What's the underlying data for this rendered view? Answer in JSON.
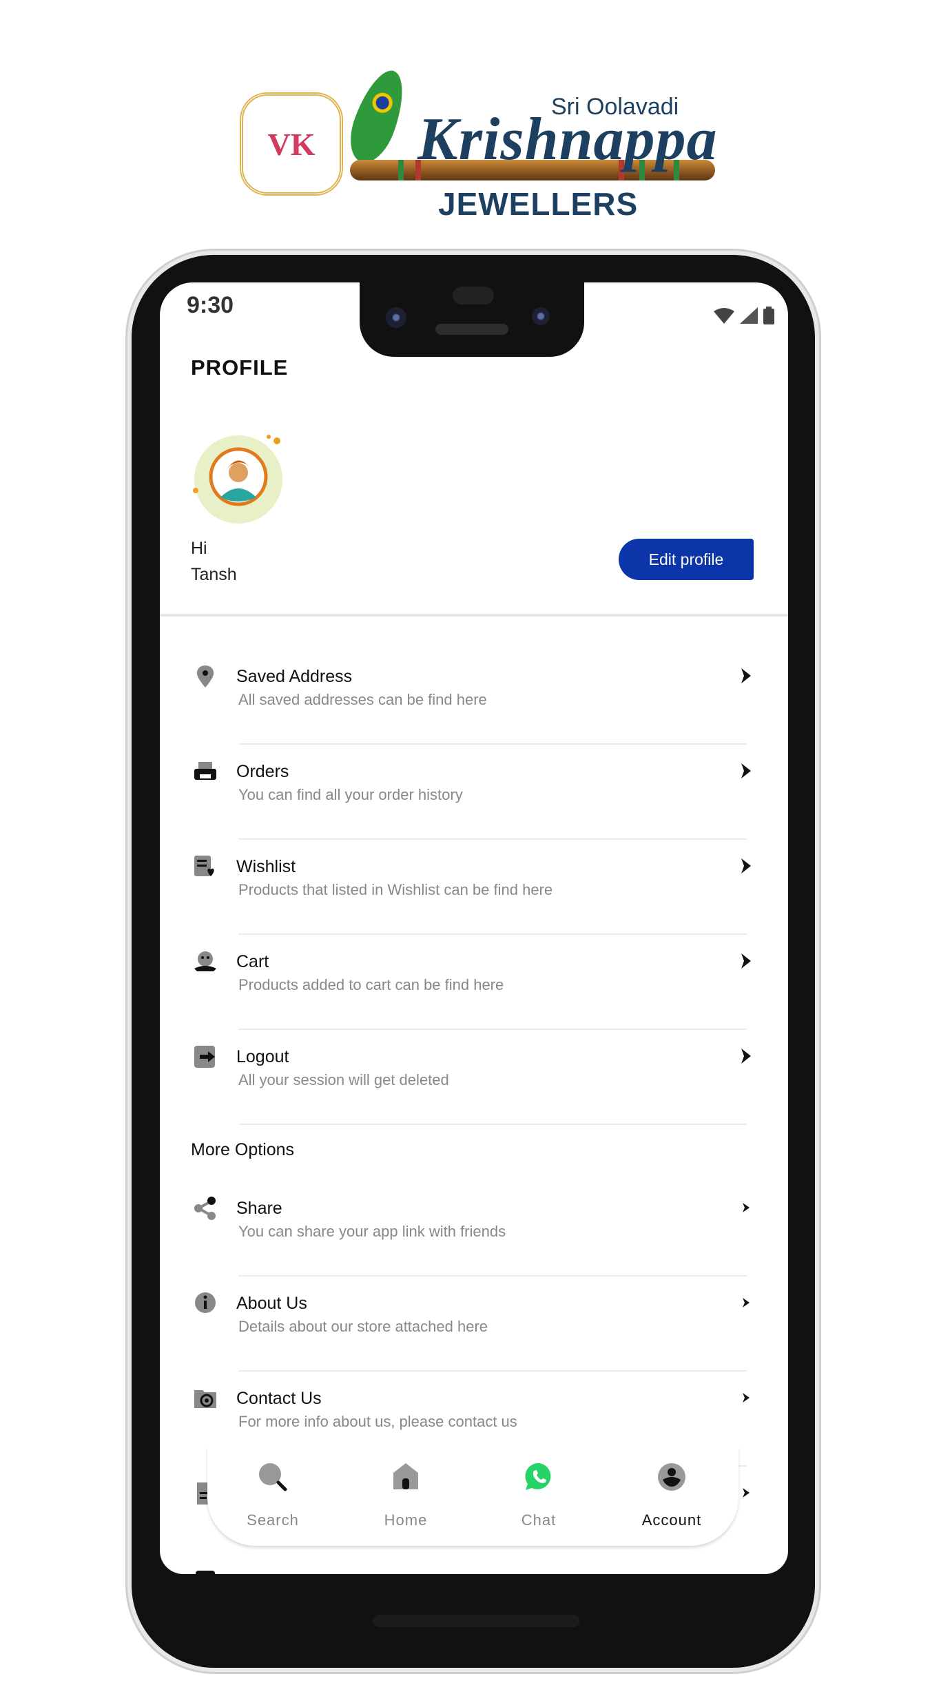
{
  "logo": {
    "monogram": "VK",
    "line1": "Sri Oolavadi",
    "line2": "Krishnappa",
    "line3": "JEWELLERS"
  },
  "status_bar": {
    "time": "9:30",
    "icons": [
      "wifi-icon",
      "signal-icon",
      "battery-icon"
    ]
  },
  "header": {
    "title": "PROFILE"
  },
  "profile": {
    "greeting": "Hi",
    "name": "Tansh",
    "edit_label": "Edit profile"
  },
  "colors": {
    "accent": "#0b35a8",
    "chat": "#25d366"
  },
  "menu": [
    {
      "icon": "location-pin-icon",
      "title": "Saved Address",
      "subtitle": "All saved addresses can be find here"
    },
    {
      "icon": "orders-icon",
      "title": "Orders",
      "subtitle": "You can find all your order history"
    },
    {
      "icon": "wishlist-icon",
      "title": "Wishlist",
      "subtitle": "Products that listed in Wishlist can be find here"
    },
    {
      "icon": "cart-icon",
      "title": "Cart",
      "subtitle": "Products added to cart can be find here"
    },
    {
      "icon": "logout-icon",
      "title": "Logout",
      "subtitle": "All your session will get deleted"
    }
  ],
  "more_options": {
    "label": "More Options",
    "items": [
      {
        "icon": "share-icon",
        "title": "Share",
        "subtitle": "You can share your app link with friends"
      },
      {
        "icon": "info-icon",
        "title": "About Us",
        "subtitle": "Details about our store attached here"
      },
      {
        "icon": "contact-icon",
        "title": "Contact Us",
        "subtitle": "For more info about us, please contact us"
      }
    ]
  },
  "bottom_nav": [
    {
      "icon": "search-icon",
      "label": "Search"
    },
    {
      "icon": "home-icon",
      "label": "Home"
    },
    {
      "icon": "whatsapp-icon",
      "label": "Chat"
    },
    {
      "icon": "account-icon",
      "label": "Account",
      "active": true
    }
  ]
}
